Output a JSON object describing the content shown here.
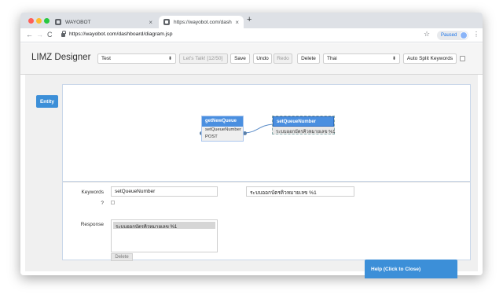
{
  "browser": {
    "tabs": [
      {
        "title": "WAYOBOT",
        "active": false
      },
      {
        "title": "https://wayobot.com/dashboar",
        "active": true
      }
    ],
    "new_tab": "+",
    "url": "https://wayobot.com/dashboard/diagram.jsp",
    "profile_status": "Paused",
    "icons": {
      "back": "←",
      "forward": "→",
      "reload": "C",
      "star": "☆",
      "menu": "⋮",
      "close": "×"
    }
  },
  "app": {
    "title": "LIMZ Designer",
    "project_select": "Test",
    "lets_talk": "Let's Talk! [12/50]",
    "save": "Save",
    "undo": "Undo",
    "redo": "Redo",
    "delete": "Delete",
    "language_select": "Thai",
    "auto_split": "Auto Split Keywords",
    "auto_split_checked": false
  },
  "sidebar": {
    "entity_button": "Entity"
  },
  "diagram": {
    "nodes": [
      {
        "title": "getNewQueue",
        "rows": [
          "setQueueNumber",
          "POST"
        ]
      },
      {
        "title": "setQueueNumber",
        "rows": [
          "ระบบออกบัตรคิวหมายเลข %1"
        ]
      }
    ]
  },
  "form": {
    "keywords_label": "Keywords",
    "keywords_value": "setQueueNumber",
    "keywords_value_2": "ระบบออกบัตรคิวหมายเลข %1",
    "question_label": "?",
    "response_label": "Response",
    "responses": [
      "ระบบออกบัตรคิวหมายเลข %1"
    ],
    "delete_button": "Delete"
  },
  "help": {
    "label": "Help (Click to Close)"
  },
  "colors": {
    "accent": "#3c8fd8",
    "node_header": "#4a8fe0"
  }
}
